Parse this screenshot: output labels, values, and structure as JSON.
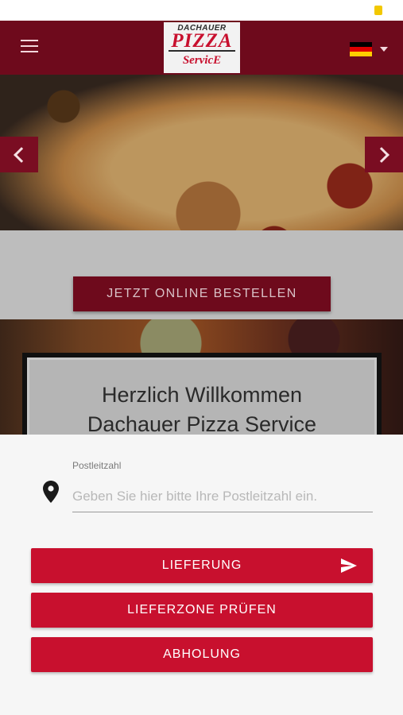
{
  "header": {
    "logo_top": "DACHAUER",
    "logo_main": "PIZZA",
    "logo_sub": "ServicE",
    "language_flag": "flag-de",
    "brand_color": "#6e0a1c"
  },
  "hero": {
    "prev_icon": "chevron-left-icon",
    "next_icon": "chevron-right-icon"
  },
  "order": {
    "button_label": "JETZT ONLINE BESTELLEN"
  },
  "welcome": {
    "line1": "Herzlich Willkommen",
    "line2": "Dachauer Pizza Service"
  },
  "delivery_sheet": {
    "postcode_label": "Postleitzahl",
    "postcode_placeholder": "Geben Sie hier bitte Ihre Postleitzahl ein.",
    "postcode_value": "",
    "buttons": [
      {
        "label": "LIEFERUNG",
        "icon": "send-icon"
      },
      {
        "label": "LIEFERZONE PRÜFEN"
      },
      {
        "label": "ABHOLUNG"
      }
    ],
    "accent_color": "#c8102e"
  }
}
